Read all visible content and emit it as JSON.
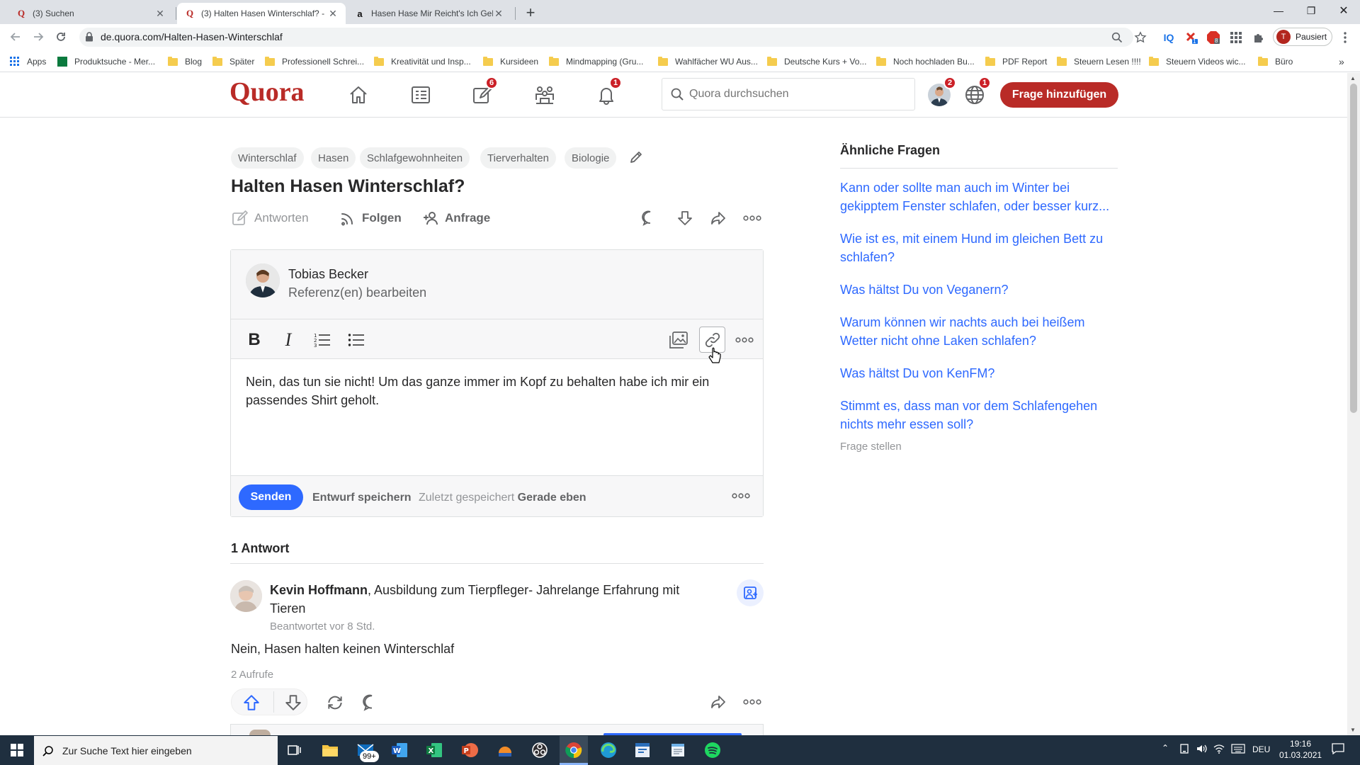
{
  "browser": {
    "tabs": [
      {
        "title": "(3) Suchen",
        "favicon": "quora-favicon"
      },
      {
        "title": "(3) Halten Hasen Winterschlaf? -",
        "favicon": "quora-favicon"
      },
      {
        "title": "Hasen Hase Mir Reicht's Ich Geh",
        "favicon": "amazon-favicon"
      }
    ],
    "url": "de.quora.com/Halten-Hasen-Winterschlaf",
    "profile_initial": "T",
    "profile_status": "Pausiert",
    "extension_badges": {
      "abp": "8",
      "ext": "1"
    },
    "bookmarks": [
      "Apps",
      "Produktsuche - Mer...",
      "Blog",
      "Später",
      "Professionell Schrei...",
      "Kreativität und Insp...",
      "Kursideen",
      "Mindmapping (Gru...",
      "Wahlfächer WU Aus...",
      "Deutsche Kurs + Vo...",
      "Noch hochladen Bu...",
      "PDF Report",
      "Steuern Lesen !!!!",
      "Steuern Videos wic...",
      "Büro"
    ]
  },
  "quora": {
    "logo": "Quora",
    "badges": {
      "answer": "6",
      "notifications": "1",
      "profile": "2",
      "language": "1"
    },
    "search_placeholder": "Quora durchsuchen",
    "add_question": "Frage hinzufügen"
  },
  "question": {
    "topics": [
      "Winterschlaf",
      "Hasen",
      "Schlafgewohnheiten",
      "Tierverhalten",
      "Biologie"
    ],
    "title": "Halten Hasen Winterschlaf?",
    "actions": {
      "answer": "Antworten",
      "follow": "Folgen",
      "request": "Anfrage"
    }
  },
  "editor": {
    "author": "Tobias Becker",
    "credentials": "Referenz(en) bearbeiten",
    "text": "Nein, das tun sie nicht! Um das ganze immer im Kopf zu behalten habe ich mir ein passendes Shirt geholt.",
    "send": "Senden",
    "save_draft": "Entwurf speichern",
    "last_saved_label": "Zuletzt gespeichert",
    "last_saved_value": "Gerade eben"
  },
  "answers": {
    "count_label": "1 Antwort",
    "items": [
      {
        "author": "Kevin Hoffmann",
        "credential": ", Ausbildung zum Tierpfleger- Jahrelange Erfahrung mit Tieren",
        "time": "Beantwortet vor 8 Std.",
        "text": "Nein, Hasen halten keinen Winterschlaf",
        "views": "2 Aufrufe"
      }
    ]
  },
  "sidebar": {
    "title": "Ähnliche Fragen",
    "questions": [
      "Kann oder sollte man auch im Winter bei gekipptem Fenster schlafen, oder besser kurz...",
      "Wie ist es, mit einem Hund im gleichen Bett zu schlafen?",
      "Was hältst Du von Veganern?",
      "Warum können wir nachts auch bei heißem Wetter nicht ohne Laken schlafen?",
      "Was hältst Du von KenFM?",
      "Stimmt es, dass man vor dem Schlafengehen nichts mehr essen soll?"
    ],
    "ask": "Frage stellen"
  },
  "taskbar": {
    "search_placeholder": "Zur Suche Text hier eingeben",
    "mail_badge": "99+",
    "language": "DEU",
    "time": "19:16",
    "date": "01.03.2021"
  }
}
